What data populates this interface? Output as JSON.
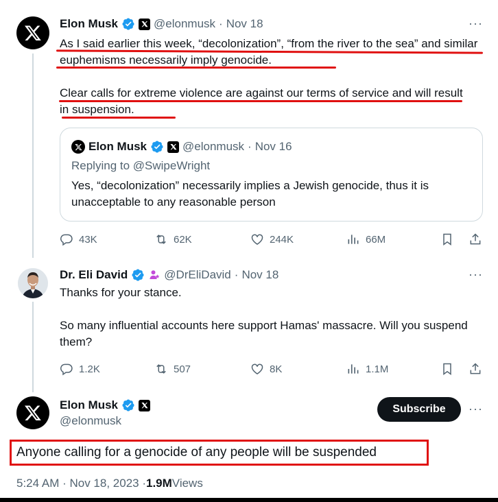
{
  "tweet1": {
    "name": "Elon Musk",
    "handle": "@elonmusk",
    "dot": "·",
    "date": "Nov 18",
    "more": "···",
    "para1": "As I said earlier this week, “decolonization”, “from the river to the sea” and similar euphemisms necessarily imply genocide.",
    "para2": "Clear calls for extreme violence are against our terms of service and will result in suspension.",
    "quote": {
      "name": "Elon Musk",
      "handle": "@elonmusk",
      "dot": "·",
      "date": "Nov 16",
      "replying_to": "Replying to @SwipeWright",
      "text": "Yes, “decolonization” necessarily implies a Jewish genocide, thus it is unacceptable to any reasonable person"
    },
    "actions": {
      "replies": "43K",
      "reposts": "62K",
      "likes": "244K",
      "views": "66M"
    }
  },
  "tweet2": {
    "name": "Dr. Eli David",
    "handle": "@DrEliDavid",
    "dot": "·",
    "date": "Nov 18",
    "more": "···",
    "para1": "Thanks for your stance.",
    "para2": "So many influential accounts here support Hamas' massacre. Will you suspend them?",
    "actions": {
      "replies": "1.2K",
      "reposts": "507",
      "likes": "8K",
      "views": "1.1M"
    }
  },
  "main_tweet": {
    "name": "Elon Musk",
    "handle": "@elonmusk",
    "subscribe_label": "Subscribe",
    "more": "···",
    "text": "Anyone calling for a genocide of any people will be suspended",
    "timestamp": "5:24 AM · Nov 18, 2023 · ",
    "views_count": "1.9M",
    "views_label": " Views"
  },
  "colors": {
    "verified": "#1d9bf0",
    "annotation_red": "#e01010",
    "secondary_text": "#536471",
    "affiliate_purple": "#c34bd9"
  },
  "icons": [
    "x-logo-icon",
    "verified-badge-icon",
    "affiliate-badge-icon",
    "reply-icon",
    "repost-icon",
    "like-icon",
    "views-icon",
    "bookmark-icon",
    "share-icon",
    "more-icon"
  ]
}
